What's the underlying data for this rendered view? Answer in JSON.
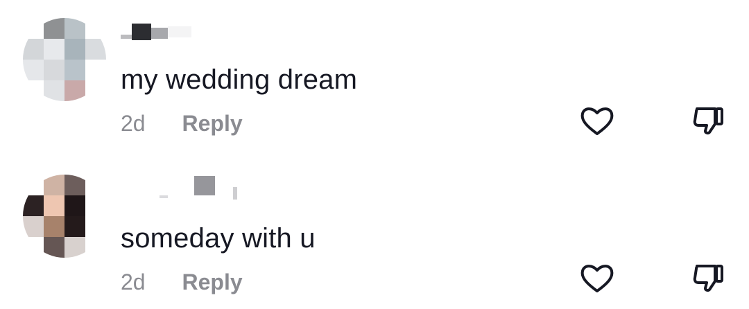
{
  "comments": [
    {
      "text": "my wedding dream",
      "age": "2d",
      "reply_label": "Reply",
      "like_icon": "heart-outline-icon",
      "dislike_icon": "thumbs-down-icon"
    },
    {
      "text": "someday with u",
      "age": "2d",
      "reply_label": "Reply",
      "like_icon": "heart-outline-icon",
      "dislike_icon": "thumbs-down-icon"
    }
  ],
  "colors": {
    "text": "#161823",
    "meta": "#8a8b91",
    "icon": "#161823"
  }
}
